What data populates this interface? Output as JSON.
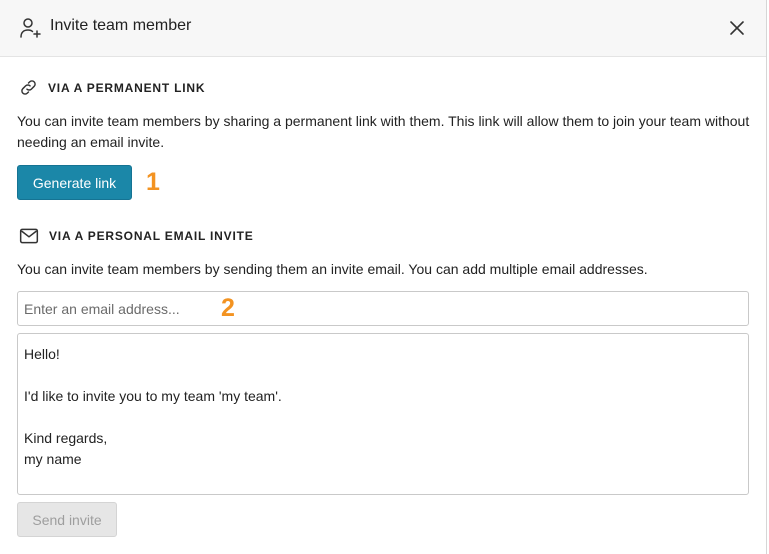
{
  "header": {
    "title": "Invite team member"
  },
  "link_section": {
    "heading": "VIA A PERMANENT LINK",
    "description": "You can invite team members by sharing a permanent link with them. This link will allow them to join your team without needing an email invite.",
    "button_label": "Generate link",
    "marker": "1"
  },
  "email_section": {
    "heading": "VIA A PERSONAL EMAIL INVITE",
    "description": "You can invite team members by sending them an invite email. You can add multiple email addresses.",
    "email_placeholder": "Enter an email address...",
    "email_value": "",
    "marker": "2",
    "message_lines": [
      "Hello!",
      "",
      "I'd like to invite you to my team 'my team'.",
      "",
      "Kind regards,",
      "my name"
    ],
    "send_label": "Send invite"
  },
  "colors": {
    "primary": "#1b87a8",
    "marker": "#f39321"
  },
  "icons": {
    "header": "user-plus-icon",
    "close": "close-icon",
    "link": "link-icon",
    "email": "mail-icon"
  }
}
